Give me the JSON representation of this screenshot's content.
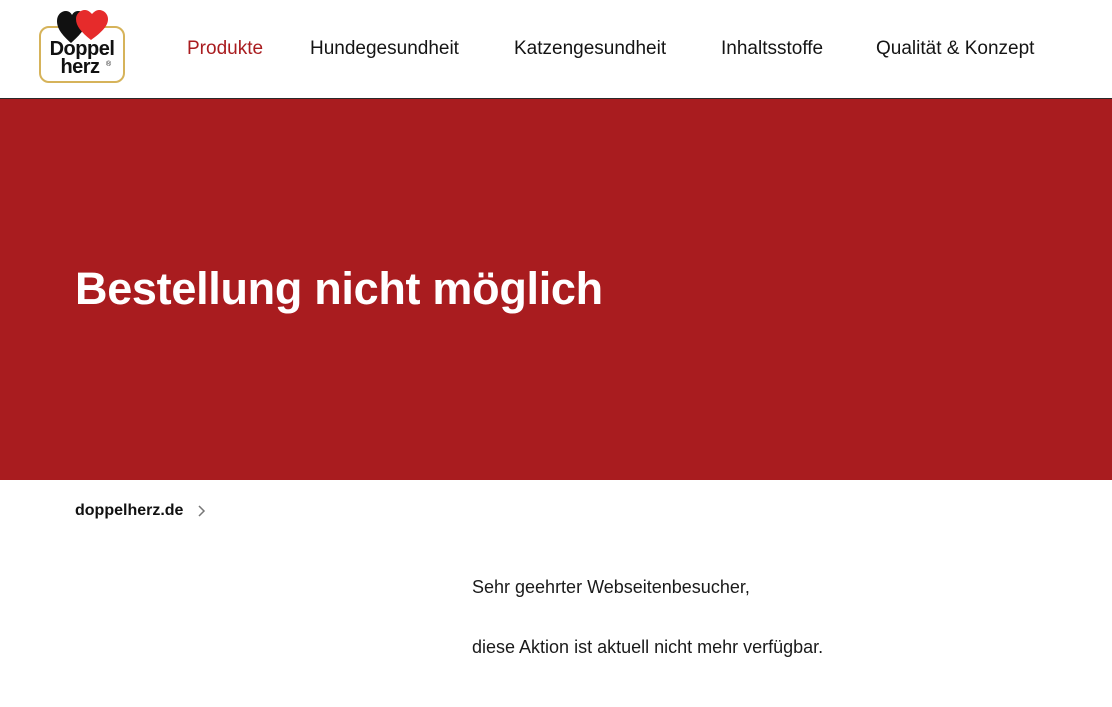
{
  "logo": {
    "line1": "Doppel",
    "line2": "herz",
    "registered": "®",
    "colors": {
      "heart_black": "#111111",
      "heart_red": "#e62b2b",
      "frame": "#d6b35a"
    }
  },
  "nav": {
    "items": [
      {
        "label": "Produkte",
        "active": true
      },
      {
        "label": "Hundegesundheit",
        "active": false
      },
      {
        "label": "Katzengesundheit",
        "active": false
      },
      {
        "label": "Inhaltsstoffe",
        "active": false
      },
      {
        "label": "Qualität & Konzept",
        "active": false
      }
    ]
  },
  "hero": {
    "title": "Bestellung nicht möglich",
    "background": "#a91c1f"
  },
  "breadcrumb": {
    "home_label": "doppelherz.de",
    "separator_icon": "chevron-right-icon"
  },
  "content": {
    "greeting": "Sehr geehrter Webseitenbesucher,",
    "message": "diese Aktion ist aktuell nicht mehr verfügbar."
  }
}
